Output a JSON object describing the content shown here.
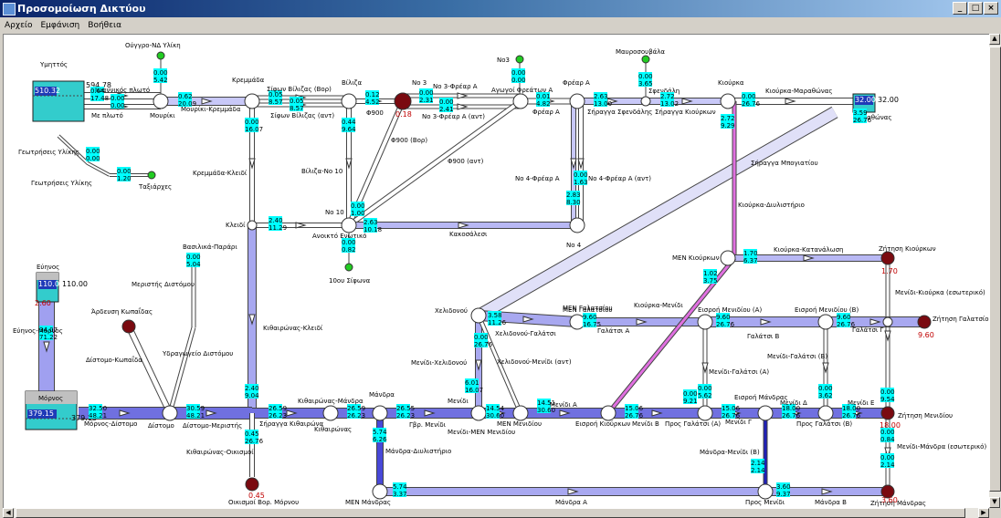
{
  "window": {
    "title": "Προσομοίωση Δικτύου",
    "buttons": {
      "minimize": "_",
      "maximize": "□",
      "close": "×"
    }
  },
  "menu": [
    "Αρχείο",
    "Εμφάνιση",
    "Βοήθεια"
  ],
  "colors": {
    "accent": "#0a246a",
    "canvas": "#ffffff",
    "flow": "#a8a8f0",
    "flow_dark": "#4848d8",
    "pipe_pink": "#e070e0",
    "node_red": "#7a0a10",
    "node_green": "#22cc22",
    "tank": "#33cccc",
    "readout": "#00ffff"
  },
  "icons": [
    "window-app-icon",
    "pipe-arrow-icon",
    "node-icon",
    "source-node-icon",
    "demand-node-icon",
    "tank-icon"
  ],
  "tanks": [
    {
      "id": "ymittos",
      "label": "Υμηττός",
      "level": "510.32",
      "side": "594.78"
    },
    {
      "id": "eyinos",
      "label": "Εύηνος",
      "level": "110.00",
      "side": "110.00",
      "red": "2.60"
    },
    {
      "id": "mornos",
      "label": "Μόρνος",
      "level": "379.15",
      "side": "379.15"
    },
    {
      "id": "marathonas",
      "label": "Μαραθώνας",
      "level": "32.00",
      "side": "32.00"
    }
  ],
  "nodes": [
    {
      "label": "Μουρίκι"
    },
    {
      "label": "Κρεμμάδα"
    },
    {
      "label": "Βίλιζα"
    },
    {
      "label": "Νο 3",
      "red": "0.18"
    },
    {
      "label": "Αγωγοί Φρεάτων Α"
    },
    {
      "label": "Φρέαρ Α"
    },
    {
      "label": "Σφενδάλη"
    },
    {
      "label": "Κιούρκα"
    },
    {
      "label": "Νο 10"
    },
    {
      "label": "Νο 4"
    },
    {
      "label": "Κλειδί"
    },
    {
      "label": "Δίστομο"
    },
    {
      "label": "Κιθαιρώνας"
    },
    {
      "label": "Μάνδρα"
    },
    {
      "label": "Μενίδι"
    },
    {
      "label": "ΜΕΝ Μενιδίου"
    },
    {
      "label": "Εισροή Κιούρκων"
    },
    {
      "label": "Προς Γαλάτσι (Α)"
    },
    {
      "label": "Εισροή Μάνδρας"
    },
    {
      "label": "Προς Γαλάτσι (Β)"
    },
    {
      "label": "Χελιδονού"
    },
    {
      "label": "ΜΕΝ Γαλατσίου"
    },
    {
      "label": "Εισροή Μενιδίου (Α)"
    },
    {
      "label": "Εισροή Μενιδίου (Β)"
    },
    {
      "label": "ΜΕΝ Κιούρκων"
    },
    {
      "label": "Προς Μενίδι"
    },
    {
      "label": "ΜΕΝ Μάνδρας"
    },
    {
      "label": "Γαλάτσι Γ"
    }
  ],
  "sources": [
    {
      "label": "Ούγγρο-ΝΔ Υλίκη"
    },
    {
      "label": "Νο3"
    },
    {
      "label": "Μαυροσουβάλα"
    },
    {
      "label": "Ταξιάρχες"
    },
    {
      "label": "10ου Σίφωνα"
    },
    {
      "label": "Βασιλικά-Παράρι"
    }
  ],
  "demands": [
    {
      "label": "Ζήτηση Κιούρκων",
      "value": "1.70"
    },
    {
      "label": "Ζήτηση Γαλατσίου",
      "value": "9.60"
    },
    {
      "label": "Ζήτηση Μενιδίου",
      "value": "18.00"
    },
    {
      "label": "Ζήτηση Μάνδρας",
      "value": "3.60"
    },
    {
      "label": "Οικισμοί Βορ. Μόρνου",
      "value": "0.45"
    },
    {
      "label": "Άρδευση Κωπαΐδας"
    }
  ],
  "pipes": [
    "Ιωαννικός πλωτό",
    "Με πλωτό",
    "Μουρίκι-Κρεμμάδα",
    "Σίφων Βίλιζας (Βορ)",
    "Σίφων Βίλιζας (αντ)",
    "Φ900",
    "Νο 3-Φρέαρ Α",
    "Νο 3-Φρέαρ Α (αντ)",
    "Φρέαρ Α",
    "Σήραγγα Σφενδάλης",
    "Σήραγγα Κιούρκων",
    "Κιούρκα-Μαραθώνας",
    "Γεωτρήσεις Υλίκης",
    "Γεωτρήσεις Υλίκης",
    "Κρεμμάδα-Κλειδί",
    "Βίλιζα-Νο 10",
    "Φ900 (Βορ)",
    "Φ900 (αντ)",
    "Νο 4-Φρέαρ Α",
    "Νο 4-Φρέαρ Α (αντ)",
    "Σήραγγα Μπογιατίου",
    "Κιούρκα-Διυλιστήριο",
    "Ανοικτό Ενωτικό",
    "Κακοσάλεσι",
    "Κιούρκα-Κατανάλωση",
    "Μεριστής Διστόμου",
    "Εύηνος-Μόρνος",
    "Υδραγωγείο Διστόμου",
    "Δίστομο-Κωπαΐδα",
    "Κιθαιρώνας-Κλειδί",
    "Χελιδονού-Γαλάτσι",
    "ΜΕΝ Γαλατσίου",
    "Κιούρκα-Μενίδι",
    "Μενίδι-Κιούρκα (εσωτερικό)",
    "Γαλάτσι Α",
    "Γαλάτσι Β",
    "Μενίδι-Γαλάτσι (Β)",
    "Μενίδι-Γαλάτσι (Α)",
    "Μενίδι-Χελιδονού",
    "Χελιδονού-Μενίδι (αντ)",
    "Μόρνος-Δίστομο",
    "Δίστομο-Μεριστής",
    "Σήραγγα Κιθαιρώνα",
    "Κιθαιρώνας-Μάνδρα",
    "Γβρ. Μενίδι",
    "Μενίδι-ΜΕΝ Μενιδίου",
    "Μενίδι Α",
    "Μενίδι Β",
    "Μενίδι Δ",
    "Μενίδι Ε",
    "Μενίδι Γ",
    "Κιθαιρώνας-Οικισμοί",
    "Μάνδρα-Διυλιστήριο",
    "Μάνδρα-Μενίδι (Β)",
    "Μενίδι-Μάνδρα (εσωτερικό)",
    "Μάνδρα Α",
    "Μάνδρα Β"
  ],
  "readouts": [
    [
      "0.64",
      "17.48"
    ],
    [
      "0.00",
      "0.00"
    ],
    [
      "0.62",
      "20.09"
    ],
    [
      "0.00",
      "5.42"
    ],
    [
      "0.05",
      "8.57"
    ],
    [
      "0.05",
      "8.57"
    ],
    [
      "0.12",
      "4.52"
    ],
    [
      "0.00",
      "2.31"
    ],
    [
      "0.00",
      "2.41"
    ],
    [
      "0.00",
      "0.00"
    ],
    [
      "0.01",
      "4.82"
    ],
    [
      "0.00",
      "3.65"
    ],
    [
      "2.63",
      "13.00"
    ],
    [
      "2.72",
      "13.02"
    ],
    [
      "0.00",
      "26.76"
    ],
    [
      "3.59",
      "26.76"
    ],
    [
      "0.00",
      "0.00"
    ],
    [
      "0.00",
      "1.20"
    ],
    [
      "0.00",
      "16.07"
    ],
    [
      "0.44",
      "9.64"
    ],
    [
      "2.72",
      "9.29"
    ],
    [
      "0.00",
      "1.63"
    ],
    [
      "2.83",
      "8.30"
    ],
    [
      "0.00",
      "1.00"
    ],
    [
      "2.40",
      "11.29"
    ],
    [
      "2.63",
      "10.18"
    ],
    [
      "0.00",
      "0.82"
    ],
    [
      "1.70",
      "6.37"
    ],
    [
      "0.00",
      "5.04"
    ],
    [
      "1.02",
      "3.75"
    ],
    [
      "3.58",
      "11.26"
    ],
    [
      "9.60",
      "16.75"
    ],
    [
      "9.60",
      "26.76"
    ],
    [
      "9.60",
      "26.76"
    ],
    [
      "0.00",
      "9.54"
    ],
    [
      "0.00",
      "3.62"
    ],
    [
      "0.00",
      "5.62"
    ],
    [
      "0.00",
      "26.76"
    ],
    [
      "34.07",
      "71.22"
    ],
    [
      "32.50",
      "48.21"
    ],
    [
      "30.59",
      "48.21"
    ],
    [
      "2.40",
      "9.04"
    ],
    [
      "26.59",
      "26.23"
    ],
    [
      "26.59",
      "26.23"
    ],
    [
      "26.55",
      "26.23"
    ],
    [
      "6.01",
      "16.07"
    ],
    [
      "14.54",
      "30.60"
    ],
    [
      "14.51",
      "30.60"
    ],
    [
      "15.06",
      "26.76"
    ],
    [
      "0.00",
      "9.21"
    ],
    [
      "15.06",
      "26.76"
    ],
    [
      "18.00",
      "26.76"
    ],
    [
      "18.00",
      "26.76"
    ],
    [
      "0.00",
      "0.84"
    ],
    [
      "0.45",
      "26.76"
    ],
    [
      "5.74",
      "6.26"
    ],
    [
      "2.14",
      "2.14"
    ],
    [
      "3.60",
      "9.37"
    ],
    [
      "0.00",
      "2.14"
    ],
    [
      "5.74",
      "3.37"
    ]
  ]
}
